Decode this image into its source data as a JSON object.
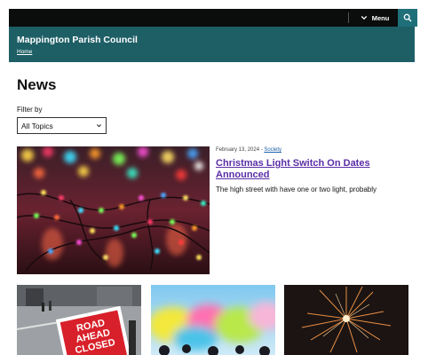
{
  "topbar": {
    "menu_label": "Menu",
    "menu_icon": "chevron-down-icon",
    "search_icon": "search-icon"
  },
  "header": {
    "site_title": "Mappington Parish Council",
    "breadcrumb": "Home"
  },
  "main": {
    "title": "News",
    "filter": {
      "label": "Filter by",
      "selected": "All Topics"
    },
    "featured": {
      "date": "February 13, 2024",
      "separator": " - ",
      "category": "Society",
      "headline": "Christmas Light Switch On Dates Announced",
      "summary": "The high street with have one or two light, probably"
    },
    "cards": [
      {
        "sign_lines": [
          "ROAD",
          "AHEAD",
          "CLOSED"
        ]
      },
      {},
      {}
    ]
  },
  "colors": {
    "topbar": "#0b0c0c",
    "header": "#1e5f66",
    "search_button": "#1f6f79",
    "headline_link": "#5a2ea6",
    "category_link": "#1d5fa8"
  }
}
